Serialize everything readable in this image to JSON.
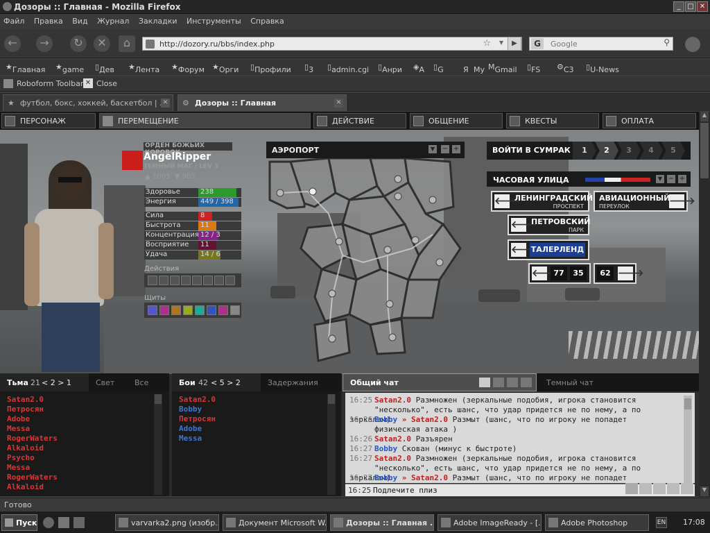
{
  "window": {
    "title": "Дозоры :: Главная - Mozilla Firefox"
  },
  "menu": [
    "Файл",
    "Правка",
    "Вид",
    "Журнал",
    "Закладки",
    "Инструменты",
    "Справка"
  ],
  "url": "http://dozory.ru/bbs/index.php",
  "search_placeholder": "Google",
  "search_engine_letter": "G",
  "bookmarks": [
    "Главная",
    "game",
    "Дев",
    "Лента",
    "Форум",
    "Орги",
    "Профили",
    "3",
    "admin.cgi",
    "Анри",
    "A",
    "G",
    "Я",
    "My",
    "Gmail",
    "FS",
    "C3",
    "U-News"
  ],
  "roboform": {
    "toolbar": "Roboform Toolbar",
    "close": "Close"
  },
  "tabs": [
    {
      "label": "футбол, бокс, хоккей, баскетбол | ..."
    },
    {
      "label": "Дозоры :: Главная"
    }
  ],
  "topnav": [
    "ПЕРСОНАЖ",
    "ПЕРЕМЕЩЕНИЕ",
    "ДЕЙСТВИЕ",
    "ОБЩЕНИЕ",
    "КВЕСТЫ",
    "ОПЛАТА"
  ],
  "character": {
    "order": "ОРДЕН БОЖЬИХ КОРОВОК",
    "name": "AngelRipper",
    "rank": "ТЕМНЫЙ МАГ / LEV 3",
    "up_count": "1003",
    "down_count": "985",
    "stats": [
      {
        "label": "Здоровье",
        "value": "238",
        "fill": 0.95,
        "color": "#2a9a2a"
      },
      {
        "label": "Энергия",
        "value": "449 / 398",
        "fill": 1.0,
        "color": "#2266aa"
      },
      {
        "label": "Сила",
        "value": "8",
        "fill": 0.35,
        "color": "#cc2222"
      },
      {
        "label": "Быстрота",
        "value": "11",
        "fill": 0.45,
        "color": "#dd7711"
      },
      {
        "label": "Концентрация",
        "value": "12 / 3",
        "fill": 0.5,
        "color": "#882288"
      },
      {
        "label": "Восприятие",
        "value": "11",
        "fill": 0.45,
        "color": "#661133"
      },
      {
        "label": "Удача",
        "value": "14 / 6",
        "fill": 0.55,
        "color": "#777722"
      }
    ],
    "actions_label": "Действия",
    "shields_label": "Щиты",
    "shield_colors": [
      "#5555cc",
      "#aa3388",
      "#aa7722",
      "#99aa22",
      "#22aa99",
      "#3355bb",
      "#aa3388",
      "#888888"
    ]
  },
  "map": {
    "title": "АЭРОПОРТ"
  },
  "twilight": {
    "label": "ВОЙТИ В СУМРАК",
    "levels": [
      "1",
      "2",
      "3",
      "4",
      "5"
    ]
  },
  "street": {
    "name": "ЧАСОВАЯ УЛИЦА",
    "exits": [
      {
        "name": "ЛЕНИНГРАДСКИЙ",
        "sub": "ПРОСПЕКТ"
      },
      {
        "name": "АВИАЦИОННЫЙ",
        "sub": "ПЕРЕУЛОК"
      },
      {
        "name": "ПЕТРОВСКИЙ",
        "sub": "ПАРК"
      },
      {
        "name": "ТАЛЕРЛЕНД",
        "sub": ""
      }
    ],
    "numbers": [
      "77",
      "35",
      "62"
    ]
  },
  "players_panel": {
    "tabs": [
      "Тьма",
      "Свет",
      "Все"
    ],
    "count": "21",
    "pager": "< 2 > 1",
    "players": [
      "Satan2.0",
      "Петросян",
      "Adobe",
      "Messa",
      "RogerWaters",
      "Alkaloid",
      "Psycho",
      "Messa",
      "RogerWaters",
      "Alkaloid"
    ]
  },
  "battles_panel": {
    "tabs": [
      "Бои",
      "Задержания"
    ],
    "count": "42",
    "pager": "< 5 > 2",
    "players": [
      {
        "name": "Satan2.0",
        "team": "red"
      },
      {
        "name": "Bobby",
        "team": "blue"
      },
      {
        "name": "Петросян",
        "team": "red"
      },
      {
        "name": "Adobe",
        "team": "blue"
      },
      {
        "name": "Messa",
        "team": "blue"
      }
    ]
  },
  "chat": {
    "tabs": [
      "Общий чат",
      "Темный чат"
    ],
    "lines": [
      {
        "time": "16:25",
        "from": "Satan2.0",
        "from_color": "red",
        "to": "",
        "text": "Размножен (зеркальные подобия, игрока становится"
      },
      {
        "time": "",
        "from": "",
        "from_color": "",
        "to": "",
        "text": "\"несколько\", есть шанс, что удар придется не по нему, а по зеркалам)"
      },
      {
        "time": "16:26",
        "from": "Bobby",
        "from_color": "blue",
        "to": "Satan2.0",
        "text": "Размыт (шанс, что по игроку не попадет"
      },
      {
        "time": "",
        "from": "",
        "from_color": "",
        "to": "",
        "text": "физическая атака )"
      },
      {
        "time": "16:26",
        "from": "Satan2.0",
        "from_color": "red",
        "to": "",
        "text": "Разъярен"
      },
      {
        "time": "16:27",
        "from": "Bobby",
        "from_color": "blue",
        "to": "",
        "text": "Скован (минус к быстроте)"
      },
      {
        "time": "16:27",
        "from": "Satan2.0",
        "from_color": "red",
        "to": "",
        "text": "Размножен (зеркальные подобия, игрока становится"
      },
      {
        "time": "",
        "from": "",
        "from_color": "",
        "to": "",
        "text": "\"несколько\", есть шанс, что удар придется не по нему, а по зеркалам)"
      },
      {
        "time": "16:27",
        "from": "Bobby",
        "from_color": "blue",
        "to": "Satan2.0",
        "text": "Размыт (шанс, что по игроку не попадет"
      }
    ],
    "input_time": "16:25",
    "input_value": "Подлечите плиз"
  },
  "status": "Готово",
  "taskbar": {
    "start": "Пуск",
    "tasks": [
      "varvarka2.png (изобр...",
      "Документ Microsoft W...",
      "Дозоры :: Главная ...",
      "Adobe ImageReady - [...",
      "Adobe Photoshop"
    ],
    "lang": "EN",
    "clock": "17:08"
  }
}
